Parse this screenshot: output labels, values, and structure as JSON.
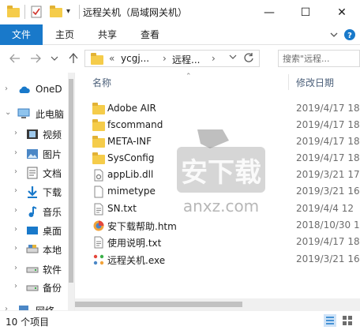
{
  "window": {
    "title": "远程关机（局域网关机）",
    "controls": {
      "minimize": "—",
      "maximize": "☐",
      "close": "✕"
    }
  },
  "ribbon": {
    "tabs": [
      {
        "label": "文件"
      },
      {
        "label": "主页"
      },
      {
        "label": "共享"
      },
      {
        "label": "查看"
      }
    ]
  },
  "address": {
    "overflow": "«",
    "crumbs": [
      "ycgj...",
      "远程..."
    ],
    "search_placeholder": "搜索\"远程..."
  },
  "nav": {
    "items": [
      {
        "label": "OneD",
        "icon": "cloud-icon"
      },
      {
        "label": "此电脑",
        "icon": "computer-icon"
      },
      {
        "label": "视频",
        "icon": "video-icon"
      },
      {
        "label": "图片",
        "icon": "picture-icon"
      },
      {
        "label": "文档",
        "icon": "document-icon"
      },
      {
        "label": "下载",
        "icon": "download-icon"
      },
      {
        "label": "音乐",
        "icon": "music-icon"
      },
      {
        "label": "桌面",
        "icon": "desktop-icon"
      },
      {
        "label": "本地",
        "icon": "drive-icon"
      },
      {
        "label": "软件",
        "icon": "drive-icon"
      },
      {
        "label": "备份",
        "icon": "drive-icon"
      },
      {
        "label": "网络",
        "icon": "network-icon"
      }
    ]
  },
  "list": {
    "columns": {
      "name": "名称",
      "date": "修改日期"
    },
    "files": [
      {
        "name": "Adobe AIR",
        "date": "2019/4/17 18",
        "icon": "folder-icon"
      },
      {
        "name": "fscommand",
        "date": "2019/4/17 18",
        "icon": "folder-icon"
      },
      {
        "name": "META-INF",
        "date": "2019/4/17 18",
        "icon": "folder-icon"
      },
      {
        "name": "SysConfig",
        "date": "2019/4/17 18",
        "icon": "folder-icon"
      },
      {
        "name": "appLib.dll",
        "date": "2019/3/21 17",
        "icon": "dll-icon"
      },
      {
        "name": "mimetype",
        "date": "2019/3/21 16",
        "icon": "blank-file-icon"
      },
      {
        "name": "SN.txt",
        "date": "2019/4/4 12",
        "icon": "text-file-icon"
      },
      {
        "name": "安下载帮助.htm",
        "date": "2018/10/30 18",
        "icon": "browser-icon"
      },
      {
        "name": "使用说明.txt",
        "date": "2019/4/17 18",
        "icon": "text-file-icon"
      },
      {
        "name": "远程关机.exe",
        "date": "2019/3/21 16",
        "icon": "app-icon"
      }
    ]
  },
  "status": {
    "item_count": "10 个项目"
  },
  "watermark": {
    "text": "安下载",
    "sub": "anxz.com"
  },
  "colors": {
    "accent": "#1979ca",
    "folder": "#f5cc4a",
    "header_text": "#4c607a"
  }
}
